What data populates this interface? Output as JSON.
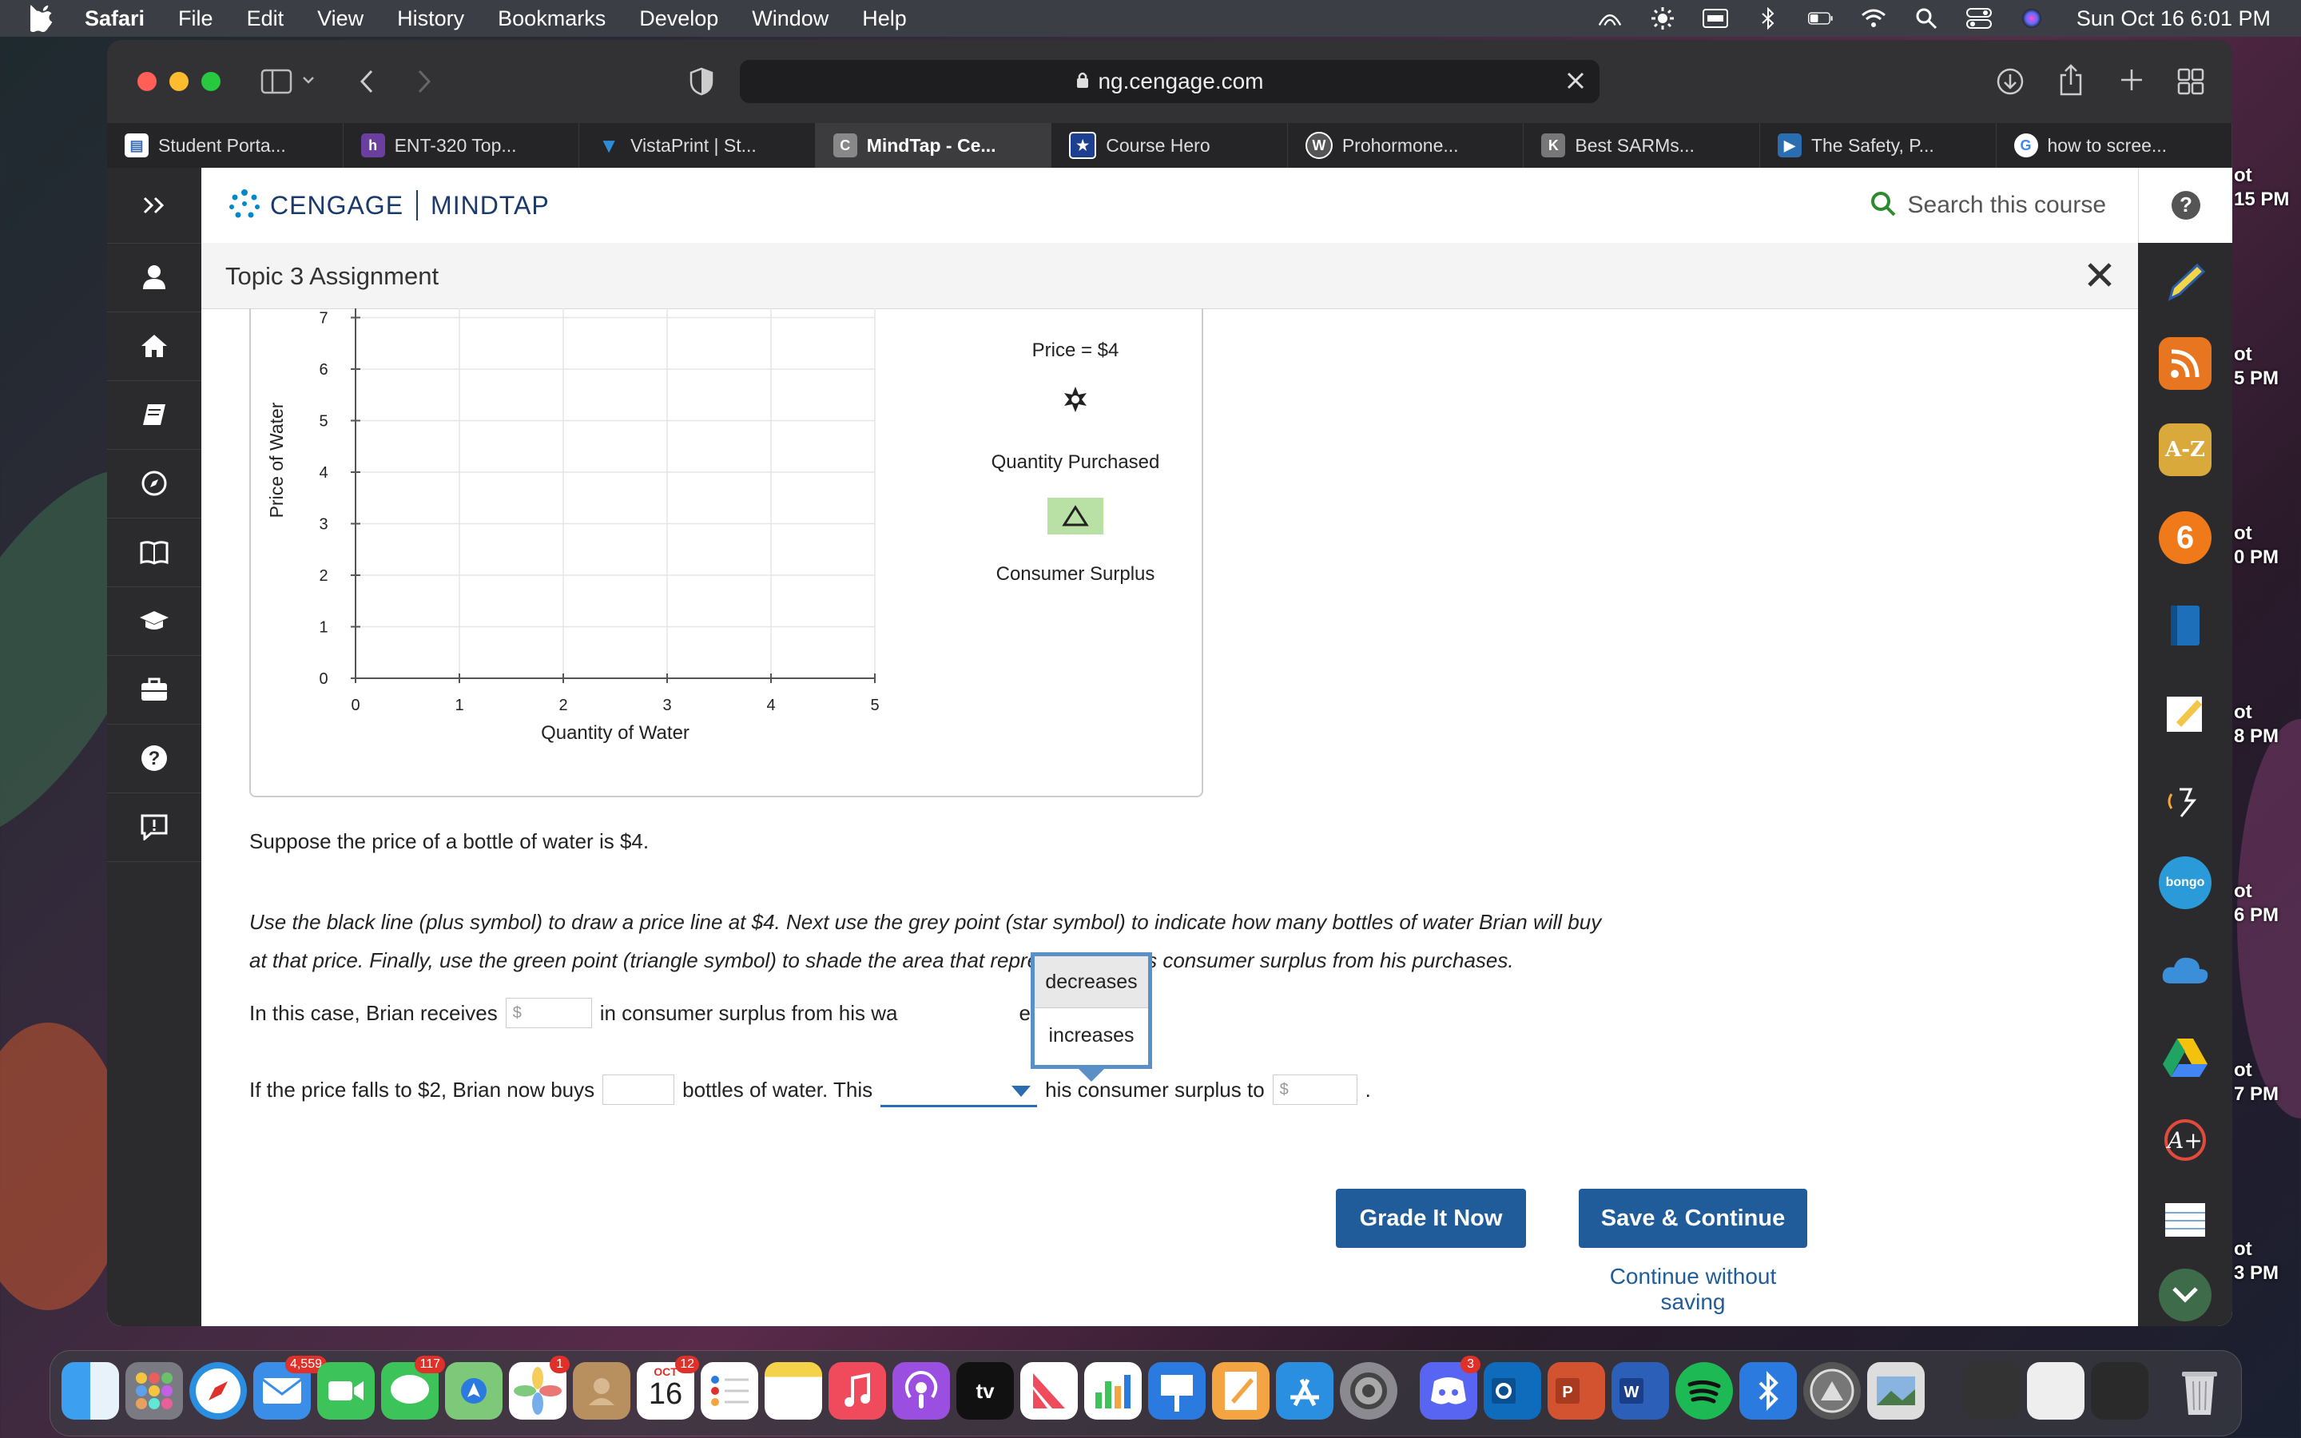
{
  "menubar": {
    "app": "Safari",
    "items": [
      "File",
      "Edit",
      "View",
      "History",
      "Bookmarks",
      "Develop",
      "Window",
      "Help"
    ],
    "datetime": "Sun Oct 16  6:01 PM"
  },
  "browser": {
    "url": "ng.cengage.com",
    "tabs": [
      {
        "label": "Student Porta...",
        "icon": "document-icon",
        "color": "#ffffff"
      },
      {
        "label": "ENT-320 Top...",
        "icon": "h-icon",
        "color": "#6b3fa0"
      },
      {
        "label": "VistaPrint | St...",
        "icon": "vistaprint-icon",
        "color": "#2d8bd8"
      },
      {
        "label": "MindTap - Ce...",
        "icon": "c-icon",
        "color": "#888888"
      },
      {
        "label": "Course Hero",
        "icon": "coursehero-icon",
        "color": "#1d3f8f"
      },
      {
        "label": "Prohormone...",
        "icon": "wordpress-icon",
        "color": "#555555"
      },
      {
        "label": "Best SARMs...",
        "icon": "k-icon",
        "color": "#777777"
      },
      {
        "label": "The Safety, P...",
        "icon": "play-icon",
        "color": "#2a6db0"
      },
      {
        "label": "how to scree...",
        "icon": "google-icon",
        "color": "#ffffff"
      }
    ]
  },
  "mindtap": {
    "brand_left": "CENGAGE",
    "brand_right": "MINDTAP",
    "search_placeholder": "Search this course",
    "assignment_title": "Topic 3 Assignment"
  },
  "graph": {
    "ylabel": "Price of Water",
    "xlabel": "Quantity of Water",
    "x_ticks": [
      "0",
      "1",
      "2",
      "3",
      "4",
      "5"
    ],
    "y_ticks": [
      "0",
      "1",
      "2",
      "3",
      "4",
      "5",
      "6",
      "7"
    ],
    "legend": [
      {
        "label": "Price = $4",
        "tool": "plus"
      },
      {
        "label": "Quantity Purchased",
        "tool": "star"
      },
      {
        "label": "Consumer Surplus",
        "tool": "triangle",
        "color": "#b9e0a5"
      }
    ]
  },
  "question": {
    "intro": "Suppose the price of a bottle of water is $4.",
    "instructions_1": "Use the black line (plus symbol) to draw a price line at $4. Next use the grey point (star symbol) to indicate how many bottles of water Brian will buy",
    "instructions_2": "at that price. Finally, use the green point (triangle symbol) to shade the area that represents Brian's consumer surplus from his purchases.",
    "line1_a": "In this case, Brian receives",
    "line1_b": "in consumer surplus from his wa",
    "line1_c": "e.",
    "dollar": "$",
    "line2_a": "If the price falls to $2, Brian now buys",
    "line2_b": "bottles of water. This",
    "line2_c": "his consumer surplus to",
    "line2_end": ".",
    "dropdown_options": [
      "decreases",
      "increases"
    ]
  },
  "actions": {
    "grade": "Grade It Now",
    "save": "Save & Continue",
    "continue": "Continue without saving"
  },
  "desktop_clips": [
    "ot",
    "15 PM",
    "ot",
    "5 PM",
    "ot",
    "0 PM",
    "ot",
    "8 PM",
    "ot",
    "6 PM",
    "ot",
    "7 PM",
    "ot",
    "3 PM"
  ],
  "dock": {
    "mail_badge": "4,559",
    "messages_badge": "117",
    "photos_badge": "1",
    "discord_badge": "3",
    "calendar_month": "OCT",
    "calendar_day": "16",
    "calendar_badge": "12",
    "tv_label": "tv"
  }
}
